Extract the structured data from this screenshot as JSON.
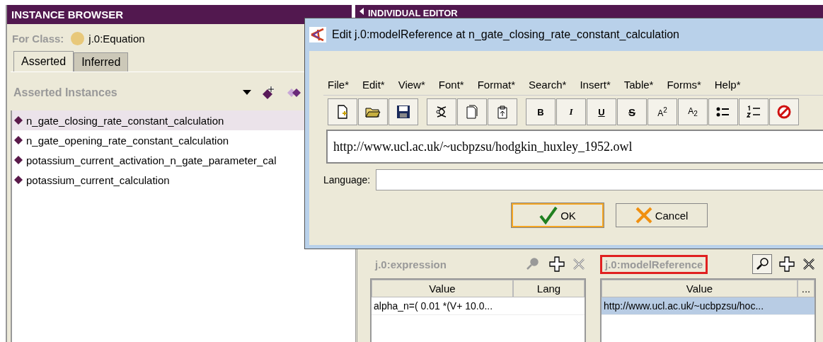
{
  "instance_browser": {
    "title": "INSTANCE BROWSER",
    "for_class_label": "For Class:",
    "class_name": "j.0:Equation",
    "tabs": [
      {
        "label": "Asserted",
        "selected": true
      },
      {
        "label": "Inferred",
        "selected": false
      }
    ],
    "list_title": "Asserted Instances",
    "instances": [
      {
        "name": "n_gate_closing_rate_constant_calculation",
        "selected": true
      },
      {
        "name": "n_gate_opening_rate_constant_calculation",
        "selected": false
      },
      {
        "name": "potassium_current_activation_n_gate_parameter_cal",
        "selected": false
      },
      {
        "name": "potassium_current_calculation",
        "selected": false
      }
    ]
  },
  "individual_editor": {
    "title": "INDIVIDUAL EDITOR",
    "properties": [
      {
        "name": "j.0:expression",
        "highlighted": false,
        "columns": [
          "Value",
          "Lang"
        ],
        "rows": [
          {
            "cells": [
              "alpha_n=( 0.01 *(V+ 10.0...",
              ""
            ],
            "selected": false
          }
        ]
      },
      {
        "name": "j.0:modelReference",
        "highlighted": true,
        "columns": [
          "Value",
          "..."
        ],
        "rows": [
          {
            "cells": [
              "http://www.ucl.ac.uk/~ucbpzsu/hoc...",
              ""
            ],
            "selected": true
          }
        ]
      }
    ]
  },
  "dialog": {
    "title": "Edit j.0:modelReference at n_gate_closing_rate_constant_calculation",
    "menu": [
      "File*",
      "Edit*",
      "View*",
      "Font*",
      "Format*",
      "Search*",
      "Insert*",
      "Table*",
      "Forms*",
      "Help*"
    ],
    "toolbar": [
      [
        {
          "kind": "new"
        },
        {
          "kind": "open"
        },
        {
          "kind": "save"
        }
      ],
      [
        {
          "kind": "cut"
        },
        {
          "kind": "copy"
        },
        {
          "kind": "paste"
        }
      ],
      [
        {
          "kind": "text",
          "label": "B"
        },
        {
          "kind": "text",
          "label": "I"
        },
        {
          "kind": "text",
          "label": "U"
        },
        {
          "kind": "text",
          "label": "S"
        },
        {
          "kind": "text",
          "label": "A$^{2}$"
        },
        {
          "kind": "text",
          "label": "A$_{2}$"
        },
        {
          "kind": "bullets"
        },
        {
          "kind": "numbering"
        },
        {
          "kind": "stop"
        }
      ]
    ],
    "value": "http://www.ucl.ac.uk/~ucbpzsu/hodgkin_huxley_1952.owl",
    "language_label": "Language:",
    "buttons": [
      {
        "label": "OK",
        "kind": "ok",
        "focused": true
      },
      {
        "label": "Cancel",
        "kind": "cancel",
        "focused": false
      }
    ]
  }
}
